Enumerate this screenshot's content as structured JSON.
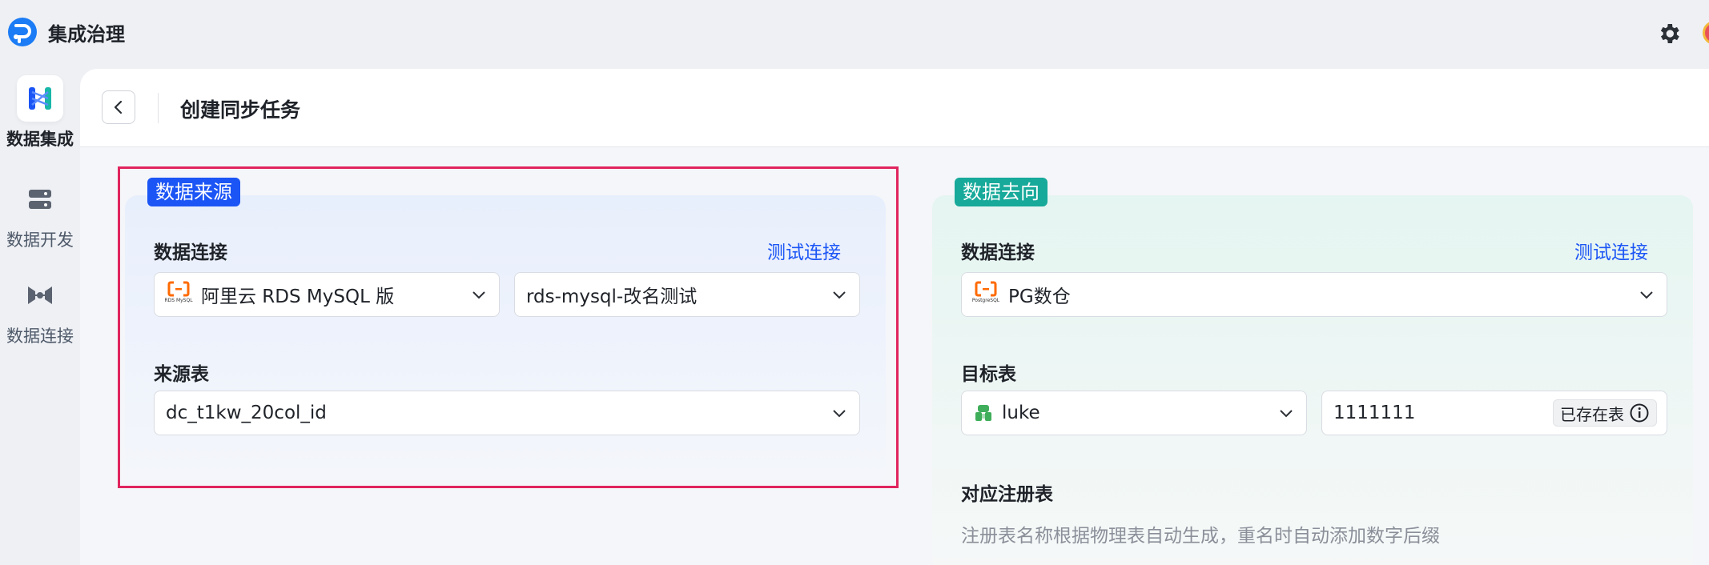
{
  "app": {
    "title": "集成治理"
  },
  "nav": {
    "items": [
      {
        "label": "数据集成",
        "active": true,
        "icon": "data-integration-icon"
      },
      {
        "label": "数据开发",
        "active": false,
        "icon": "data-dev-icon"
      },
      {
        "label": "数据连接",
        "active": false,
        "icon": "data-connection-icon"
      }
    ]
  },
  "page": {
    "title": "创建同步任务"
  },
  "source": {
    "tag": "数据来源",
    "connection_label": "数据连接",
    "test_link": "测试连接",
    "db_type": {
      "value": "阿里云 RDS MySQL 版",
      "logo_caption": "RDS MySQL"
    },
    "instance": {
      "value": "rds-mysql-改名测试"
    },
    "table_label": "来源表",
    "table": {
      "value": "dc_t1kw_20col_id"
    }
  },
  "dest": {
    "tag": "数据去向",
    "connection_label": "数据连接",
    "test_link": "测试连接",
    "db_type": {
      "value": "PG数仓",
      "logo_caption": "PostgreSQL"
    },
    "table_label": "目标表",
    "schema": {
      "value": "luke"
    },
    "table": {
      "value": "1111111",
      "badge": "已存在表"
    },
    "register_label": "对应注册表",
    "register_hint": "注册表名称根据物理表自动生成，重名时自动添加数字后缀"
  },
  "colors": {
    "primary": "#1b55f5",
    "dest_tag": "#17a99a",
    "highlight": "#e0245e"
  }
}
